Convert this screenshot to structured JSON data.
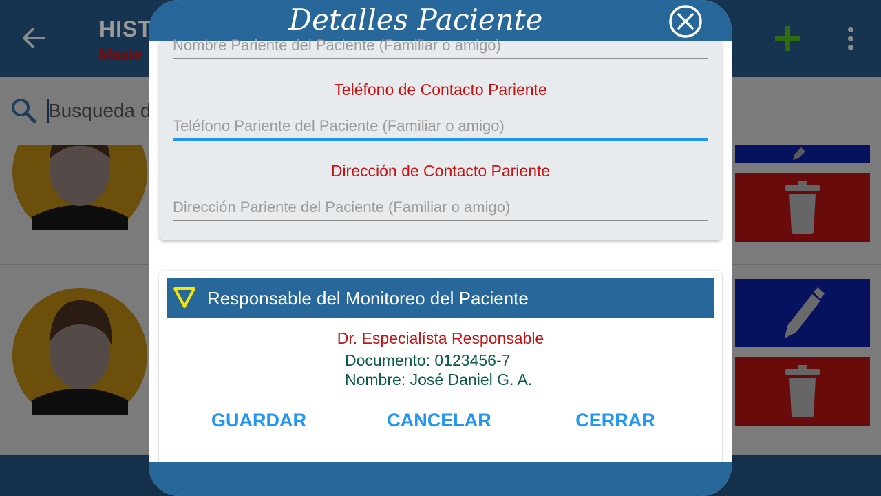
{
  "app": {
    "title": "HISTO",
    "subtitle": "Maste",
    "search_placeholder": "Busqueda d",
    "colors": {
      "appbar": "#16344f",
      "edit": "#06125e",
      "delete": "#6a0b0b"
    }
  },
  "dialog": {
    "title": "Detalles Paciente",
    "fields": {
      "relative_name_value": "Nombre Pariente del Paciente (Familiar o amigo)",
      "phone_label": "Teléfono de Contacto Pariente",
      "phone_placeholder": "Teléfono Pariente del Paciente (Familiar o amigo)",
      "address_label": "Dirección de Contacto Pariente",
      "address_placeholder": "Dirección Pariente del Paciente (Familiar o amigo)"
    },
    "monitor": {
      "section_title": "Responsable del Monitoreo del Paciente",
      "role": "Dr. Especialísta Responsable",
      "document": "Documento: 0123456-7",
      "name": "Nombre: José Daniel G. A."
    },
    "buttons": {
      "save": "GUARDAR",
      "cancel": "CANCELAR",
      "close": "CERRAR"
    },
    "colors": {
      "header": "#286799",
      "label_red": "#cc1010",
      "button_blue": "#2196f3",
      "focus_line": "#2196f3",
      "doc_text": "#0b5a4a"
    }
  },
  "icons": [
    "back-arrow-icon",
    "add-icon",
    "more-vert-icon",
    "search-icon",
    "close-circle-icon",
    "triangle-down-icon",
    "pencil-icon",
    "trash-icon",
    "avatar-icon"
  ]
}
